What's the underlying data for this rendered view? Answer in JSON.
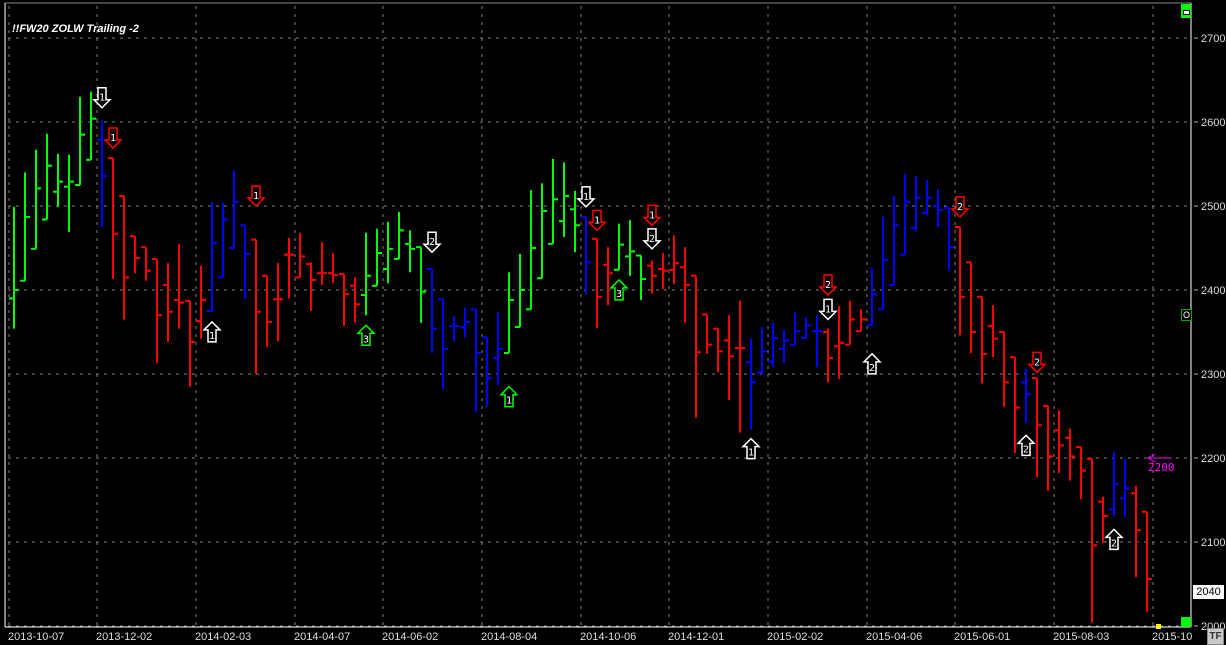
{
  "title": "!!FW20 ZOLW Trailing -2",
  "colors": {
    "G": "#00ff00",
    "B": "#0000ff",
    "R": "#ff0000",
    "marker_white": "#ffffff",
    "marker_red": "#ff0000",
    "marker_green": "#00ff00",
    "magenta": "#ff00ff",
    "grid": "#808080"
  },
  "current_price": "2040",
  "tf_button": "TF",
  "mid_icon": "O",
  "chart_data": {
    "type": "ohlc",
    "title": "!!FW20 ZOLW Trailing -2",
    "interval": "weekly",
    "ylim": [
      2000,
      2700
    ],
    "yticks": [
      "2000",
      "2100",
      "2200",
      "2300",
      "2400",
      "2500",
      "2600",
      "2700"
    ],
    "xticks": [
      {
        "bar": 0,
        "label": "2013-10-07"
      },
      {
        "bar": 8,
        "label": "2013-12-02"
      },
      {
        "bar": 17,
        "label": "2014-02-03"
      },
      {
        "bar": 26,
        "label": "2014-04-07"
      },
      {
        "bar": 34,
        "label": "2014-06-02"
      },
      {
        "bar": 43,
        "label": "2014-08-04"
      },
      {
        "bar": 52,
        "label": "2014-10-06"
      },
      {
        "bar": 60,
        "label": "2014-12-01"
      },
      {
        "bar": 69,
        "label": "2015-02-02"
      },
      {
        "bar": 78,
        "label": "2015-04-06"
      },
      {
        "bar": 86,
        "label": "2015-06-01"
      },
      {
        "bar": 95,
        "label": "2015-08-03"
      },
      {
        "bar": 104,
        "label": "2015-10"
      }
    ],
    "bar_fields": [
      "open",
      "high",
      "low",
      "close",
      "trend"
    ],
    "bars": [
      [
        2390,
        2499,
        2354,
        2400,
        "G"
      ],
      [
        2411,
        2540,
        2411,
        2487,
        "G"
      ],
      [
        2449,
        2567,
        2449,
        2521,
        "G"
      ],
      [
        2484,
        2586,
        2484,
        2548,
        "G"
      ],
      [
        2517,
        2562,
        2499,
        2529,
        "G"
      ],
      [
        2523,
        2561,
        2469,
        2529,
        "G"
      ],
      [
        2525,
        2630,
        2525,
        2585,
        "G"
      ],
      [
        2555,
        2636,
        2555,
        2604,
        "G"
      ],
      [
        2579,
        2602,
        2475,
        2536,
        "B"
      ],
      [
        2557,
        2557,
        2413,
        2467,
        "R"
      ],
      [
        2512,
        2512,
        2365,
        2415,
        "R"
      ],
      [
        2464,
        2464,
        2420,
        2438,
        "R"
      ],
      [
        2451,
        2451,
        2411,
        2423,
        "R"
      ],
      [
        2437,
        2437,
        2313,
        2370,
        "R"
      ],
      [
        2406,
        2432,
        2338,
        2374,
        "R"
      ],
      [
        2388,
        2455,
        2354,
        2385,
        "R"
      ],
      [
        2387,
        2387,
        2285,
        2338,
        "R"
      ],
      [
        2363,
        2429,
        2342,
        2388,
        "R"
      ],
      [
        2375,
        2505,
        2375,
        2456,
        "B"
      ],
      [
        2415,
        2504,
        2415,
        2484,
        "B"
      ],
      [
        2450,
        2542,
        2450,
        2505,
        "B"
      ],
      [
        2477,
        2477,
        2390,
        2443,
        "B"
      ],
      [
        2460,
        2460,
        2300,
        2374,
        "R"
      ],
      [
        2417,
        2417,
        2332,
        2362,
        "R"
      ],
      [
        2389,
        2432,
        2339,
        2389,
        "R"
      ],
      [
        2442,
        2462,
        2390,
        2442,
        "R"
      ],
      [
        2415,
        2468,
        2415,
        2440,
        "R"
      ],
      [
        2431,
        2433,
        2375,
        2412,
        "R"
      ],
      [
        2420,
        2457,
        2406,
        2420,
        "R"
      ],
      [
        2420,
        2444,
        2408,
        2418,
        "R"
      ],
      [
        2419,
        2419,
        2357,
        2395,
        "R"
      ],
      [
        2405,
        2415,
        2361,
        2383,
        "R"
      ],
      [
        2394,
        2468,
        2370,
        2417,
        "G"
      ],
      [
        2405,
        2473,
        2405,
        2444,
        "G"
      ],
      [
        2425,
        2481,
        2408,
        2449,
        "G"
      ],
      [
        2437,
        2493,
        2437,
        2471,
        "G"
      ],
      [
        2455,
        2471,
        2421,
        2449,
        "G"
      ],
      [
        2451,
        2451,
        2361,
        2398,
        "G"
      ],
      [
        2425,
        2425,
        2325,
        2354,
        "B"
      ],
      [
        2389,
        2389,
        2282,
        2330,
        "B"
      ],
      [
        2357,
        2369,
        2339,
        2357,
        "B"
      ],
      [
        2356,
        2379,
        2344,
        2362,
        "B"
      ],
      [
        2377,
        2377,
        2255,
        2325,
        "B"
      ],
      [
        2344,
        2344,
        2261,
        2295,
        "B"
      ],
      [
        2319,
        2374,
        2287,
        2330,
        "B"
      ],
      [
        2325,
        2421,
        2325,
        2388,
        "G"
      ],
      [
        2356,
        2443,
        2356,
        2400,
        "G"
      ],
      [
        2377,
        2519,
        2377,
        2450,
        "G"
      ],
      [
        2414,
        2527,
        2414,
        2494,
        "G"
      ],
      [
        2455,
        2556,
        2455,
        2508,
        "G"
      ],
      [
        2482,
        2552,
        2463,
        2512,
        "G"
      ],
      [
        2496,
        2518,
        2445,
        2477,
        "G"
      ],
      [
        2487,
        2487,
        2395,
        2433,
        "B"
      ],
      [
        2461,
        2461,
        2355,
        2392,
        "R"
      ],
      [
        2430,
        2451,
        2382,
        2420,
        "R"
      ],
      [
        2424,
        2479,
        2424,
        2454,
        "G"
      ],
      [
        2440,
        2483,
        2417,
        2446,
        "G"
      ],
      [
        2441,
        2441,
        2388,
        2413,
        "G"
      ],
      [
        2429,
        2435,
        2396,
        2417,
        "R"
      ],
      [
        2425,
        2444,
        2401,
        2423,
        "R"
      ],
      [
        2424,
        2465,
        2407,
        2432,
        "R"
      ],
      [
        2427,
        2451,
        2361,
        2406,
        "R"
      ],
      [
        2417,
        2417,
        2248,
        2326,
        "R"
      ],
      [
        2371,
        2371,
        2324,
        2335,
        "R"
      ],
      [
        2354,
        2354,
        2302,
        2327,
        "R"
      ],
      [
        2340,
        2370,
        2269,
        2321,
        "R"
      ],
      [
        2331,
        2387,
        2230,
        2331,
        "R"
      ],
      [
        2314,
        2342,
        2234,
        2290,
        "B"
      ],
      [
        2302,
        2356,
        2299,
        2327,
        "B"
      ],
      [
        2315,
        2361,
        2308,
        2343,
        "B"
      ],
      [
        2330,
        2352,
        2313,
        2340,
        "B"
      ],
      [
        2335,
        2373,
        2335,
        2351,
        "B"
      ],
      [
        2343,
        2367,
        2343,
        2358,
        "B"
      ],
      [
        2351,
        2370,
        2308,
        2351,
        "B"
      ],
      [
        2350,
        2354,
        2290,
        2319,
        "R"
      ],
      [
        2333,
        2381,
        2294,
        2337,
        "R"
      ],
      [
        2335,
        2387,
        2335,
        2365,
        "R"
      ],
      [
        2351,
        2377,
        2351,
        2365,
        "R"
      ],
      [
        2358,
        2426,
        2358,
        2395,
        "B"
      ],
      [
        2377,
        2487,
        2377,
        2436,
        "B"
      ],
      [
        2406,
        2512,
        2406,
        2477,
        "B"
      ],
      [
        2442,
        2538,
        2442,
        2505,
        "B"
      ],
      [
        2474,
        2536,
        2470,
        2510,
        "B"
      ],
      [
        2492,
        2531,
        2489,
        2510,
        "B"
      ],
      [
        2500,
        2519,
        2475,
        2495,
        "B"
      ],
      [
        2498,
        2498,
        2423,
        2451,
        "B"
      ],
      [
        2475,
        2475,
        2346,
        2392,
        "R"
      ],
      [
        2433,
        2433,
        2325,
        2350,
        "R"
      ],
      [
        2392,
        2392,
        2289,
        2324,
        "R"
      ],
      [
        2357,
        2382,
        2320,
        2342,
        "R"
      ],
      [
        2350,
        2350,
        2261,
        2290,
        "R"
      ],
      [
        2320,
        2320,
        2206,
        2260,
        "R"
      ],
      [
        2290,
        2306,
        2242,
        2276,
        "B"
      ],
      [
        2295,
        2295,
        2177,
        2239,
        "R"
      ],
      [
        2262,
        2262,
        2161,
        2202,
        "R"
      ],
      [
        2233,
        2257,
        2182,
        2215,
        "R"
      ],
      [
        2224,
        2235,
        2173,
        2202,
        "R"
      ],
      [
        2213,
        2213,
        2151,
        2185,
        "R"
      ],
      [
        2199,
        2199,
        2004,
        2096,
        "R"
      ],
      [
        2148,
        2154,
        2099,
        2131,
        "R"
      ],
      [
        2139,
        2208,
        2130,
        2169,
        "B"
      ],
      [
        2152,
        2199,
        2130,
        2164,
        "B"
      ],
      [
        2158,
        2167,
        2058,
        2114,
        "R"
      ],
      [
        2136,
        2136,
        2017,
        2056,
        "R"
      ]
    ],
    "markers": [
      {
        "bar": 8,
        "price": 2617,
        "dir": "down",
        "color": "white",
        "label": "1"
      },
      {
        "bar": 9,
        "price": 2569,
        "dir": "down",
        "color": "red",
        "label": "1"
      },
      {
        "bar": 18,
        "price": 2362,
        "dir": "up",
        "color": "white",
        "label": "1"
      },
      {
        "bar": 22,
        "price": 2500,
        "dir": "down",
        "color": "red",
        "label": "1"
      },
      {
        "bar": 32,
        "price": 2358,
        "dir": "up",
        "color": "green",
        "label": "3"
      },
      {
        "bar": 38,
        "price": 2445,
        "dir": "down",
        "color": "white",
        "label": "2"
      },
      {
        "bar": 45,
        "price": 2285,
        "dir": "up",
        "color": "green",
        "label": "1"
      },
      {
        "bar": 52,
        "price": 2499,
        "dir": "down",
        "color": "white",
        "label": "1"
      },
      {
        "bar": 53,
        "price": 2471,
        "dir": "down",
        "color": "red",
        "label": "1"
      },
      {
        "bar": 55,
        "price": 2412,
        "dir": "up",
        "color": "green",
        "label": "3"
      },
      {
        "bar": 58,
        "price": 2477,
        "dir": "down",
        "color": "red",
        "label": "1"
      },
      {
        "bar": 58,
        "price": 2449,
        "dir": "down",
        "color": "white",
        "label": "2"
      },
      {
        "bar": 67,
        "price": 2223,
        "dir": "up",
        "color": "white",
        "label": "1"
      },
      {
        "bar": 74,
        "price": 2394,
        "dir": "down",
        "color": "red",
        "label": "2"
      },
      {
        "bar": 74,
        "price": 2365,
        "dir": "down",
        "color": "white",
        "label": "1"
      },
      {
        "bar": 78,
        "price": 2324,
        "dir": "up",
        "color": "white",
        "label": "2"
      },
      {
        "bar": 86,
        "price": 2487,
        "dir": "down",
        "color": "red",
        "label": "2"
      },
      {
        "bar": 92,
        "price": 2227,
        "dir": "up",
        "color": "white",
        "label": "2"
      },
      {
        "bar": 93,
        "price": 2302,
        "dir": "down",
        "color": "red",
        "label": "2"
      },
      {
        "bar": 100,
        "price": 2115,
        "dir": "up",
        "color": "white",
        "label": "2"
      }
    ],
    "target": {
      "price": 2200,
      "label": "2200"
    }
  }
}
